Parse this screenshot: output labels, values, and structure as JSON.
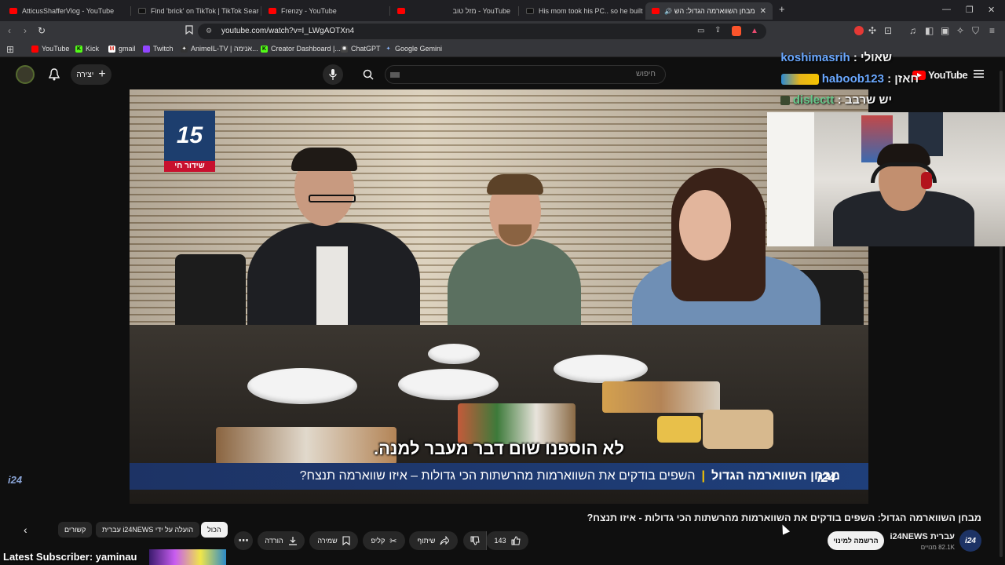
{
  "browser": {
    "tabs": [
      {
        "title": "AtticusShafferVlog - YouTube",
        "favicon": "youtube-favicon"
      },
      {
        "title": "Find 'brick' on TikTok | TikTok Search",
        "favicon": "tiktok-favicon"
      },
      {
        "title": "Frenzy - YouTube",
        "favicon": "youtube-favicon"
      },
      {
        "title": "YouTube - מזל טוב",
        "favicon": "youtube-favicon"
      },
      {
        "title": "His mom took his PC.. so he built a n",
        "favicon": "tiktok-favicon"
      },
      {
        "title": "מבחן השווארמה הגדול: השפי",
        "favicon": "youtube-favicon",
        "active": true
      }
    ],
    "url": "youtube.com/watch?v=I_LWgAOTXn4",
    "bookmarks": [
      "YouTube",
      "Kick",
      "gmail",
      "Twitch",
      "AnimeIL-TV | אנימה...",
      "Creator Dashboard |...",
      "ChatGPT",
      "Google Gemini"
    ]
  },
  "youtube": {
    "search_placeholder": "חיפוש",
    "create_label": "יצירה",
    "logo_text": "YouTube"
  },
  "video": {
    "channel_badge": "15",
    "live_label": "שידור חי",
    "subtitle": "לא הוספנו שום דבר מעבר למנה.",
    "lower_third_brand": "i24",
    "lower_third_headline": "מבחן השווארמה הגדול",
    "lower_third_body": "השפים בודקים את השווארמות מהרשתות הכי גדולות – איזו שווארמה תנצח?"
  },
  "stream_chat": [
    {
      "label": "שאולי :",
      "user": "koshimasrih"
    },
    {
      "label": "חאזן :",
      "user": "haboob123"
    },
    {
      "label": "יש שרבב :",
      "user": "dislectt"
    }
  ],
  "watch": {
    "title": "מבחן השווארמה הגדול: השפים בודקים את השווארמות מהרשתות הכי גדולות - איזו תנצח?",
    "channel_name": "i24NEWS עברית",
    "channel_subs": "82.1K מנויים",
    "channel_avatar": "i24",
    "subscribe_label": "הרשמה למינוי",
    "like_count": "143",
    "share_label": "שיתוף",
    "clip_label": "קליפ",
    "save_label": "שמירה",
    "download_label": "הורדה",
    "chips": [
      "הכול",
      "הועלה על ידי i24NEWS עברית",
      "קשורים"
    ]
  },
  "overlay": {
    "latest_subscriber": "Latest Subscriber: yaminau",
    "side_logo": "i24"
  },
  "colors": {
    "youtube_red": "#ff0000",
    "chat_user": "#6aa8ff",
    "i24_blue": "#1d3365",
    "live_red": "#c8102e"
  }
}
